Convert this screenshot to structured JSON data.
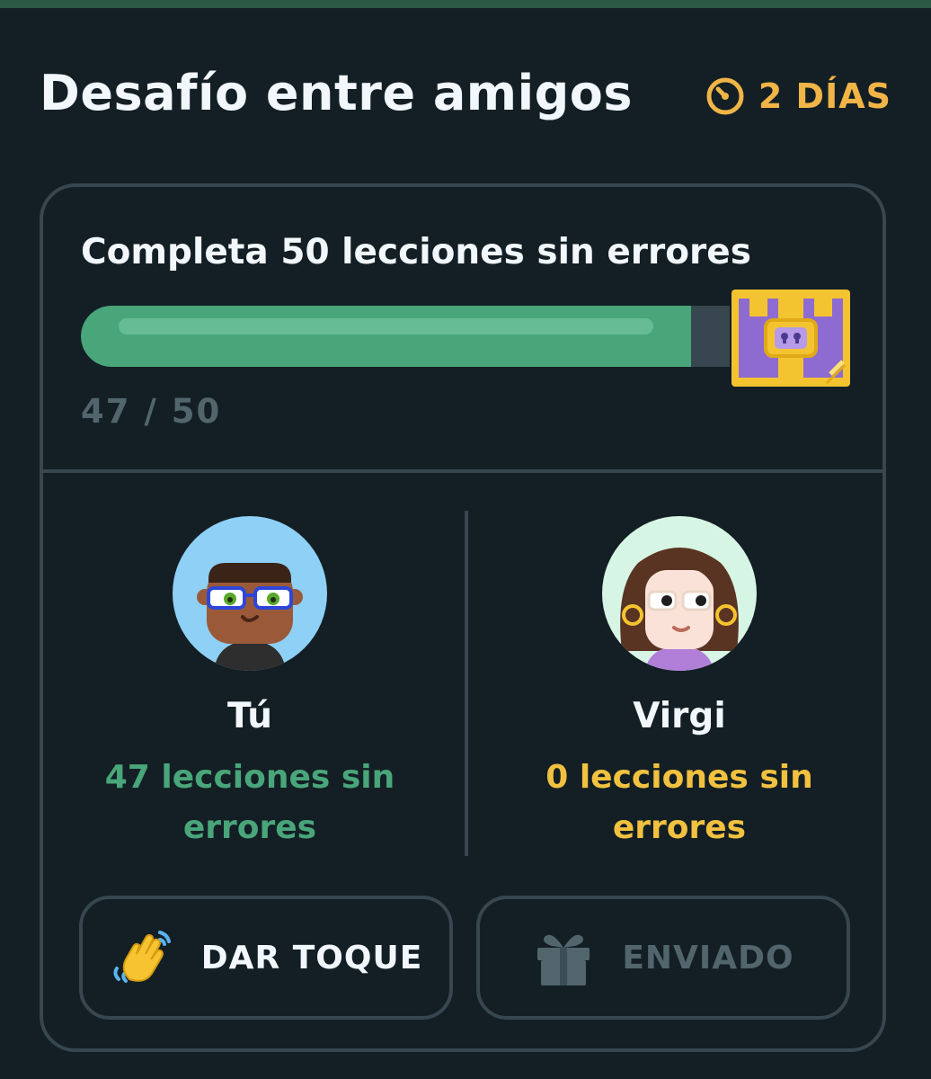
{
  "header": {
    "title": "Desafío entre amigos",
    "timer_label": "2 DÍAS",
    "timer_icon": "clock-icon"
  },
  "challenge": {
    "goal": "Completa 50 lecciones sin errores",
    "progress_current": 47,
    "progress_total": 50,
    "progress_label": "47 / 50",
    "reward_icon": "treasure-chest-icon"
  },
  "players": [
    {
      "name": "Tú",
      "stat_line1": "47 lecciones sin",
      "stat_line2": "errores"
    },
    {
      "name": "Virgi",
      "stat_line1": "0 lecciones sin",
      "stat_line2": "errores"
    }
  ],
  "actions": {
    "nudge_label": "DAR TOQUE",
    "nudge_icon": "waving-hand-icon",
    "sent_label": "ENVIADO",
    "sent_icon": "gift-icon"
  },
  "colors": {
    "background": "#131f24",
    "accent_green": "#49a57a",
    "accent_yellow": "#f1c13f",
    "timer_orange": "#f1b447",
    "border": "#37464f"
  }
}
